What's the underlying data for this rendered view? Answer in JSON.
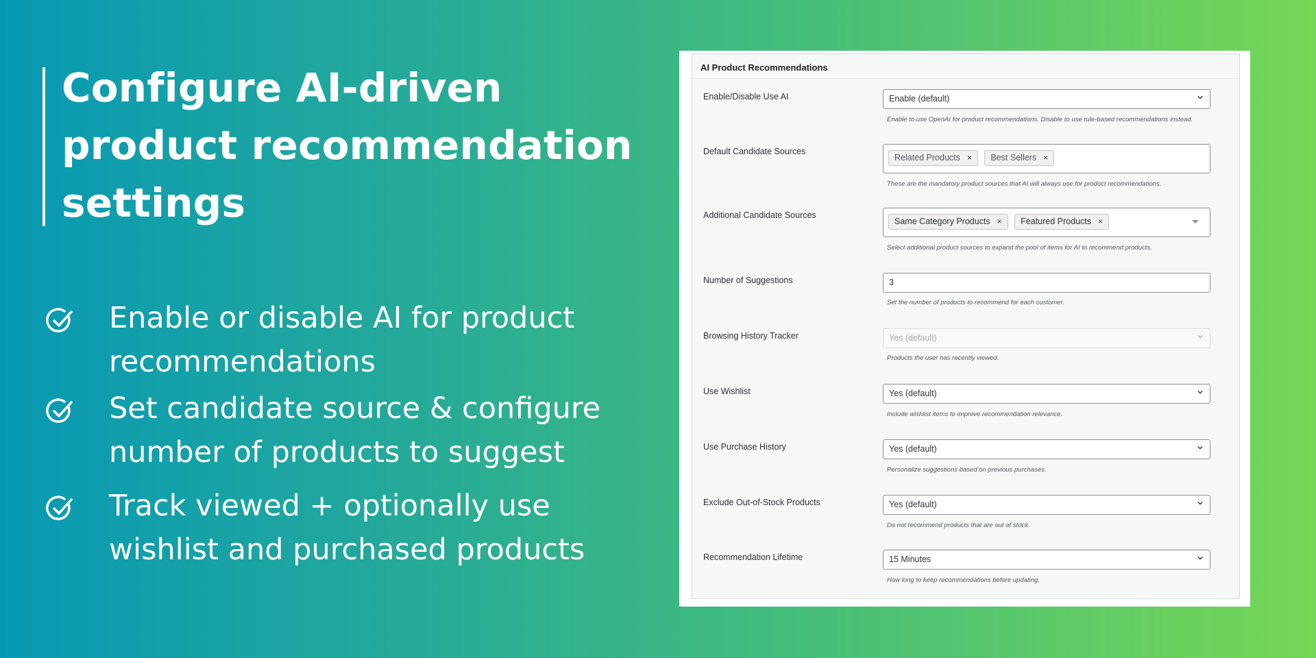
{
  "headline": {
    "line1": "Configure AI-driven",
    "line2": "product recommendation",
    "line3": "settings"
  },
  "features": [
    {
      "icon": "check-circle-icon",
      "line1": "Enable or disable AI for product",
      "line2": "recommendations"
    },
    {
      "icon": "check-circle-icon",
      "line1": "Set candidate source & configure",
      "line2": "number of products to suggest"
    },
    {
      "icon": "check-circle-icon",
      "line1": "Track viewed + optionally use",
      "line2": "wishlist and purchased products"
    }
  ],
  "panel": {
    "title": "AI Product Recommendations",
    "fields": {
      "use_ai": {
        "label": "Enable/Disable Use AI",
        "value": "Enable (default)",
        "desc": "Enable to use OpenAI for product recommendations. Disable to use rule-based recommendations instead."
      },
      "default_sources": {
        "label": "Default Candidate Sources",
        "tags": [
          "Related Products",
          "Best Sellers"
        ],
        "remove_glyph": "×",
        "desc": "These are the mandatory product sources that AI will always use for product recommendations."
      },
      "additional_sources": {
        "label": "Additional Candidate Sources",
        "tags": [
          "Same Category Products",
          "Featured Products"
        ],
        "remove_glyph": "×",
        "desc": "Select additional product sources to expand the pool of items for AI to recommend products."
      },
      "num_suggestions": {
        "label": "Number of Suggestions",
        "value": "3",
        "desc": "Set the number of products to recommend for each customer."
      },
      "browsing_history": {
        "label": "Browsing History Tracker",
        "value": "Yes (default)",
        "disabled": true,
        "desc": "Products the user has recently viewed."
      },
      "use_wishlist": {
        "label": "Use Wishlist",
        "value": "Yes (default)",
        "desc": "Include wishlist items to improve recommendation relevance."
      },
      "use_purchase_history": {
        "label": "Use Purchase History",
        "value": "Yes (default)",
        "desc": "Personalize suggestions based on previous purchases."
      },
      "exclude_oos": {
        "label": "Exclude Out-of-Stock Products",
        "value": "Yes (default)",
        "desc": "Do not recommend products that are out of stock."
      },
      "lifetime": {
        "label": "Recommendation Lifetime",
        "value": "15 Minutes",
        "desc": "How long to keep recommendations before updating."
      }
    }
  },
  "colors": {
    "gradient_start": "#0799b4",
    "gradient_end": "#76d655",
    "text_light": "#ffffff",
    "panel_bg": "#f6f7f7"
  }
}
